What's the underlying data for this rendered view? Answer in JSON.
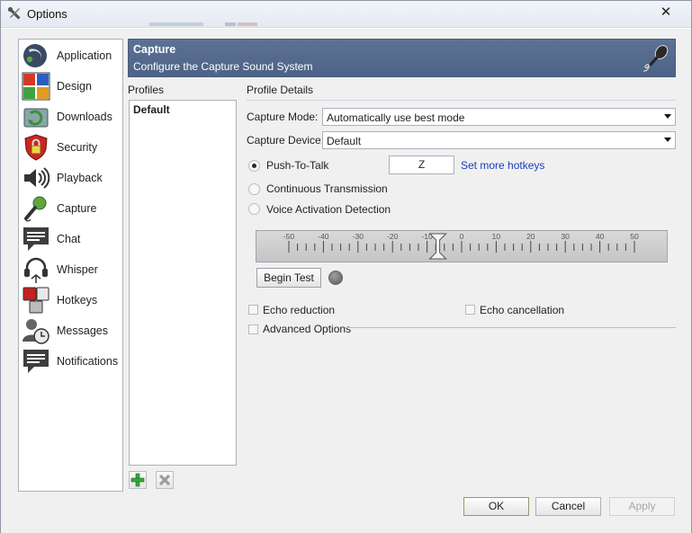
{
  "window": {
    "title": "Options",
    "close_symbol": "✕"
  },
  "sidebar": {
    "items": [
      {
        "label": "Application",
        "icon": "application-icon"
      },
      {
        "label": "Design",
        "icon": "design-icon"
      },
      {
        "label": "Downloads",
        "icon": "downloads-icon"
      },
      {
        "label": "Security",
        "icon": "security-icon"
      },
      {
        "label": "Playback",
        "icon": "playback-icon"
      },
      {
        "label": "Capture",
        "icon": "capture-icon"
      },
      {
        "label": "Chat",
        "icon": "chat-icon"
      },
      {
        "label": "Whisper",
        "icon": "whisper-icon"
      },
      {
        "label": "Hotkeys",
        "icon": "hotkeys-icon"
      },
      {
        "label": "Messages",
        "icon": "messages-icon"
      },
      {
        "label": "Notifications",
        "icon": "notifications-icon"
      }
    ]
  },
  "header": {
    "title": "Capture",
    "subtitle": "Configure the Capture Sound System",
    "icon": "microphone-icon"
  },
  "profiles": {
    "label": "Profiles",
    "items": [
      "Default"
    ],
    "add_icon": "plus-icon",
    "delete_icon": "x-icon"
  },
  "details": {
    "label": "Profile Details",
    "capture_mode": {
      "label": "Capture Mode:",
      "value": "Automatically use best mode"
    },
    "capture_device": {
      "label": "Capture Device:",
      "value": "Default"
    },
    "push_to_talk": {
      "label": "Push-To-Talk",
      "checked": true,
      "hotkey": "Z"
    },
    "set_more_hotkeys": "Set more hotkeys",
    "continuous": {
      "label": "Continuous Transmission",
      "checked": false
    },
    "vad": {
      "label": "Voice Activation Detection",
      "checked": false
    },
    "meter": {
      "ticks": [
        -50,
        -40,
        -30,
        -20,
        -10,
        0,
        10,
        20,
        30,
        40,
        50
      ],
      "min": -50,
      "max": 50,
      "threshold": -10
    },
    "begin_test": "Begin Test",
    "echo_reduction": {
      "label": "Echo reduction",
      "checked": false
    },
    "echo_cancellation": {
      "label": "Echo cancellation",
      "checked": false
    },
    "advanced_options": {
      "label": "Advanced Options",
      "checked": false
    }
  },
  "buttons": {
    "ok": "OK",
    "cancel": "Cancel",
    "apply": "Apply"
  },
  "colors": {
    "header_bg": "#5d7193",
    "link": "#1a3fb8"
  }
}
